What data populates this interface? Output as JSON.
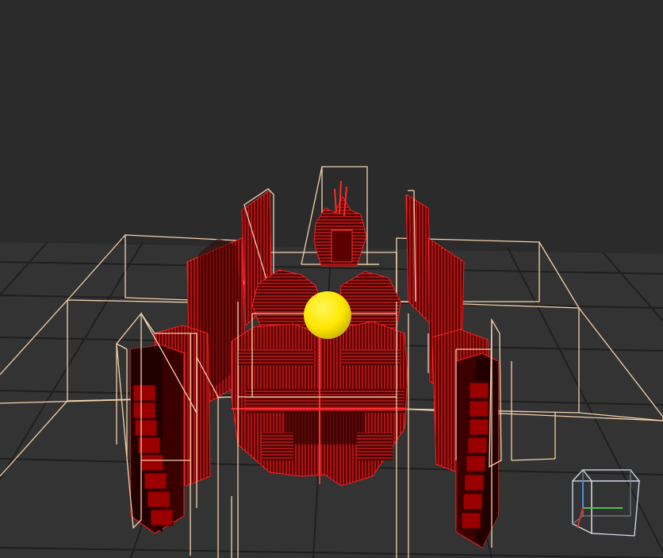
{
  "scene": {
    "background_color": "#2b2b2b",
    "floor_color": "#333333",
    "grid_line_color": "#1f1f1f",
    "bounding_box_color": "#f3d2aa",
    "fractal_color": "#cc0000",
    "fractal_edge_color": "#ff2020",
    "light_sphere_color": "#ffee00"
  },
  "icons": {
    "light_gizmo": "yellow-sphere-light",
    "orientation_gizmo": "view-cube-axes"
  }
}
